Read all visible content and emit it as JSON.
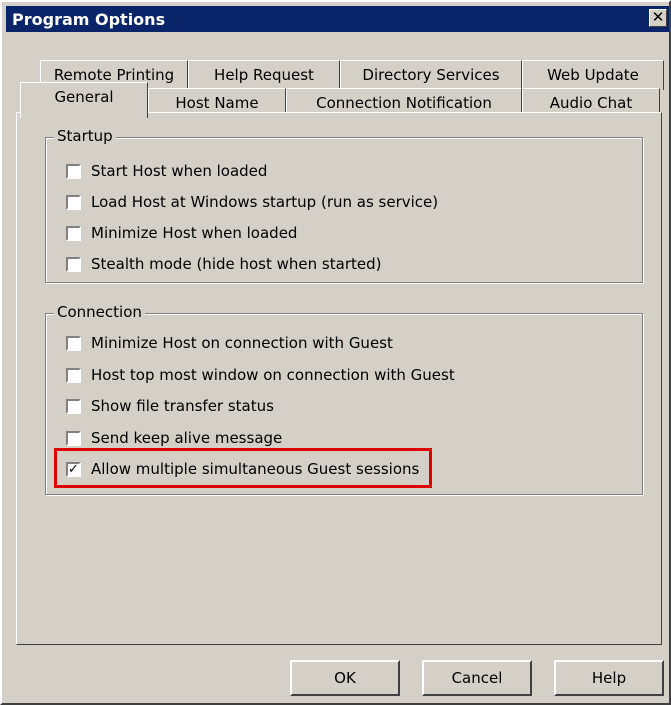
{
  "window": {
    "title": "Program Options",
    "close_glyph": "✕"
  },
  "tabs_back": [
    {
      "label": "Remote Printing"
    },
    {
      "label": "Help Request"
    },
    {
      "label": "Directory Services"
    },
    {
      "label": "Web Update"
    }
  ],
  "tabs_front": [
    {
      "label": "General",
      "active": true
    },
    {
      "label": "Host Name"
    },
    {
      "label": "Connection Notification"
    },
    {
      "label": "Audio Chat"
    }
  ],
  "startup": {
    "label": "Startup",
    "options": [
      {
        "label": "Start Host when loaded",
        "checked": false
      },
      {
        "label": "Load Host at Windows startup (run as service)",
        "checked": false
      },
      {
        "label": "Minimize Host when loaded",
        "checked": false
      },
      {
        "label": "Stealth mode (hide host when started)",
        "checked": false
      }
    ]
  },
  "connection": {
    "label": "Connection",
    "options": [
      {
        "label": "Minimize Host on connection with Guest",
        "checked": false
      },
      {
        "label": "Host top most window on connection with Guest",
        "checked": false
      },
      {
        "label": "Show file transfer status",
        "checked": false
      },
      {
        "label": "Send keep alive message",
        "checked": false
      },
      {
        "label": "Allow multiple simultaneous Guest sessions",
        "checked": true
      }
    ]
  },
  "buttons": {
    "ok": "OK",
    "cancel": "Cancel",
    "help": "Help"
  },
  "colors": {
    "titlebar": "#0a246a",
    "face": "#d4d0c8",
    "highlight": "#e00000"
  },
  "check_glyph": "✓"
}
